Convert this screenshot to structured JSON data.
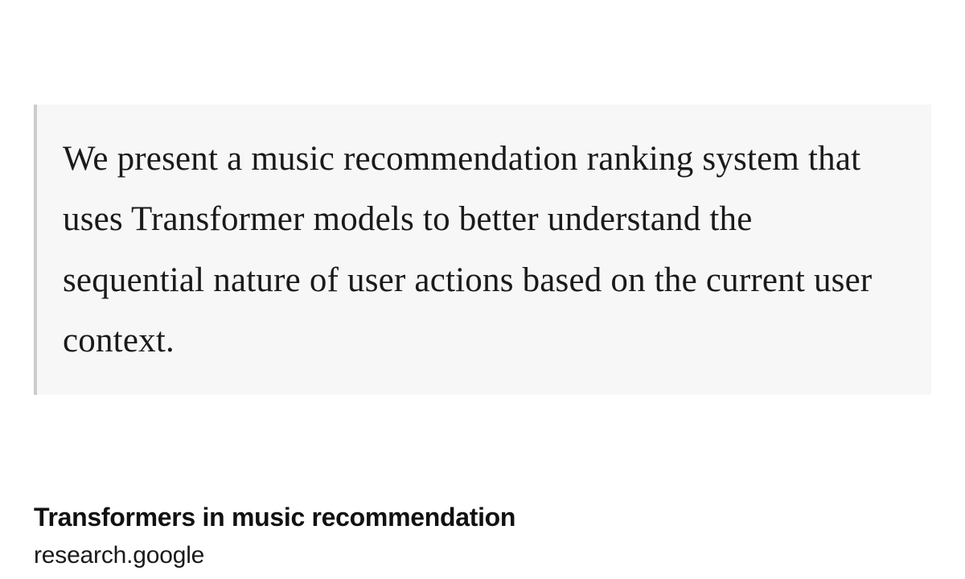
{
  "quote": {
    "text": "We present a music recommendation ranking system that uses Transformer models to better understand the sequential nature of user actions based on the current user context."
  },
  "citation": {
    "title": "Transformers in music recommendation",
    "source": "research.google"
  }
}
